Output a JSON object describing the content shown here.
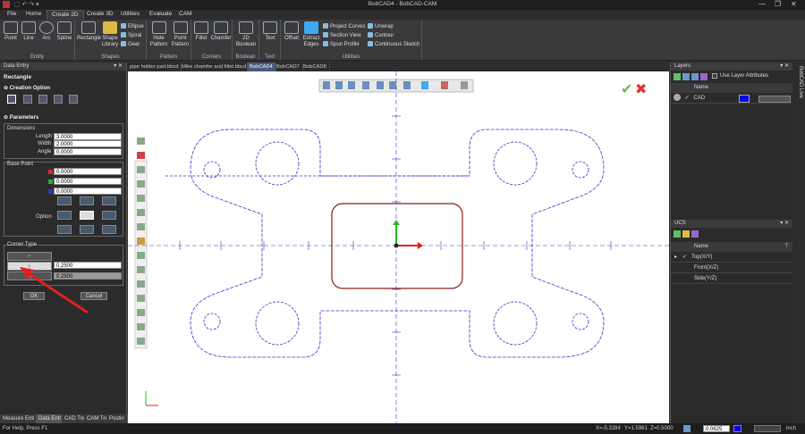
{
  "window": {
    "title": "BobCAD4 - BobCAD-CAM"
  },
  "ribbon_tabs": [
    "File",
    "Home",
    "Create 2D",
    "Create 3D",
    "Utilities",
    "Evaluate",
    "CAM"
  ],
  "ribbon": {
    "entity": {
      "label": "Entity",
      "point": "Point",
      "line": "Line",
      "arc": "Arc",
      "spline": "Spline"
    },
    "shapes": {
      "label": "Shapes",
      "rectangle": "Rectangle",
      "shape_library": "Shape Library",
      "ellipse": "Ellipse",
      "spiral": "Spiral",
      "gear": "Gear"
    },
    "pattern": {
      "label": "Pattern",
      "hole": "Hole Pattern",
      "point": "Point Pattern"
    },
    "corners": {
      "label": "Corners",
      "fillet": "Fillet",
      "chamfer": "Chamfer"
    },
    "boolean": {
      "label": "Boolean",
      "boolean2d": "2D Boolean"
    },
    "text": {
      "label": "Text",
      "text": "Text"
    },
    "utilities": {
      "label": "Utilities",
      "offset": "Offset",
      "extract_edges": "Extract Edges",
      "project_curves": "Project Curves",
      "section_view": "Section View",
      "spun_profile": "Spun Profile",
      "unwrap": "Unwrap",
      "contour": "Contour",
      "continuous_sketch": "Continuous Sketch"
    }
  },
  "data_entry": {
    "panel_title": "Data Entry",
    "heading": "Rectangle",
    "creation_option": "Creation Option",
    "parameters": "Parameters",
    "dimensions": "Dimensions",
    "length_label": "Length",
    "length": "3.0000",
    "width_label": "Width",
    "width": "2.0000",
    "angle_label": "Angle",
    "angle": "0.0000",
    "base_point": "Base Point",
    "bx": "0.0000",
    "by": "0.0000",
    "bz": "0.0000",
    "option_label": "Option",
    "corner_type": "Corner Type",
    "corner_value1": "0.2500",
    "corner_value2": "0.2500",
    "ok": "OK",
    "cancel": "Cancel"
  },
  "bottom_tabs": [
    "Measure Enti",
    "Data Entr",
    "CAD Tre",
    "CAM Tre",
    "Postin"
  ],
  "doc_tabs": [
    "pipe holder part.bbcd",
    "Mike chamfer and fillet.bbcd",
    "BobCAD4",
    "BobCAD7",
    "BobCAD8"
  ],
  "layers": {
    "title": "Layers",
    "use_layer_attributes": "Use Layer Attributes",
    "col_name": "Name",
    "rows": [
      {
        "name": "CAD",
        "color": "#0000ff"
      }
    ]
  },
  "ucs": {
    "title": "UCS",
    "col_name": "Name",
    "rows": [
      "Top(X/Y)",
      "Front(X/Z)",
      "Side(Y/Z)"
    ]
  },
  "side_strip": "BobCAD Live",
  "status": {
    "help": "For Help, Press F1",
    "x": "X=-5.3284",
    "y": "Y=1.5961",
    "z": "Z=0.5000",
    "step": "0.0625",
    "units": "inch"
  },
  "colors": {
    "geometry": "#3333cc",
    "rectangle": "#8b1a1a",
    "accent": "#3fa9f5"
  }
}
